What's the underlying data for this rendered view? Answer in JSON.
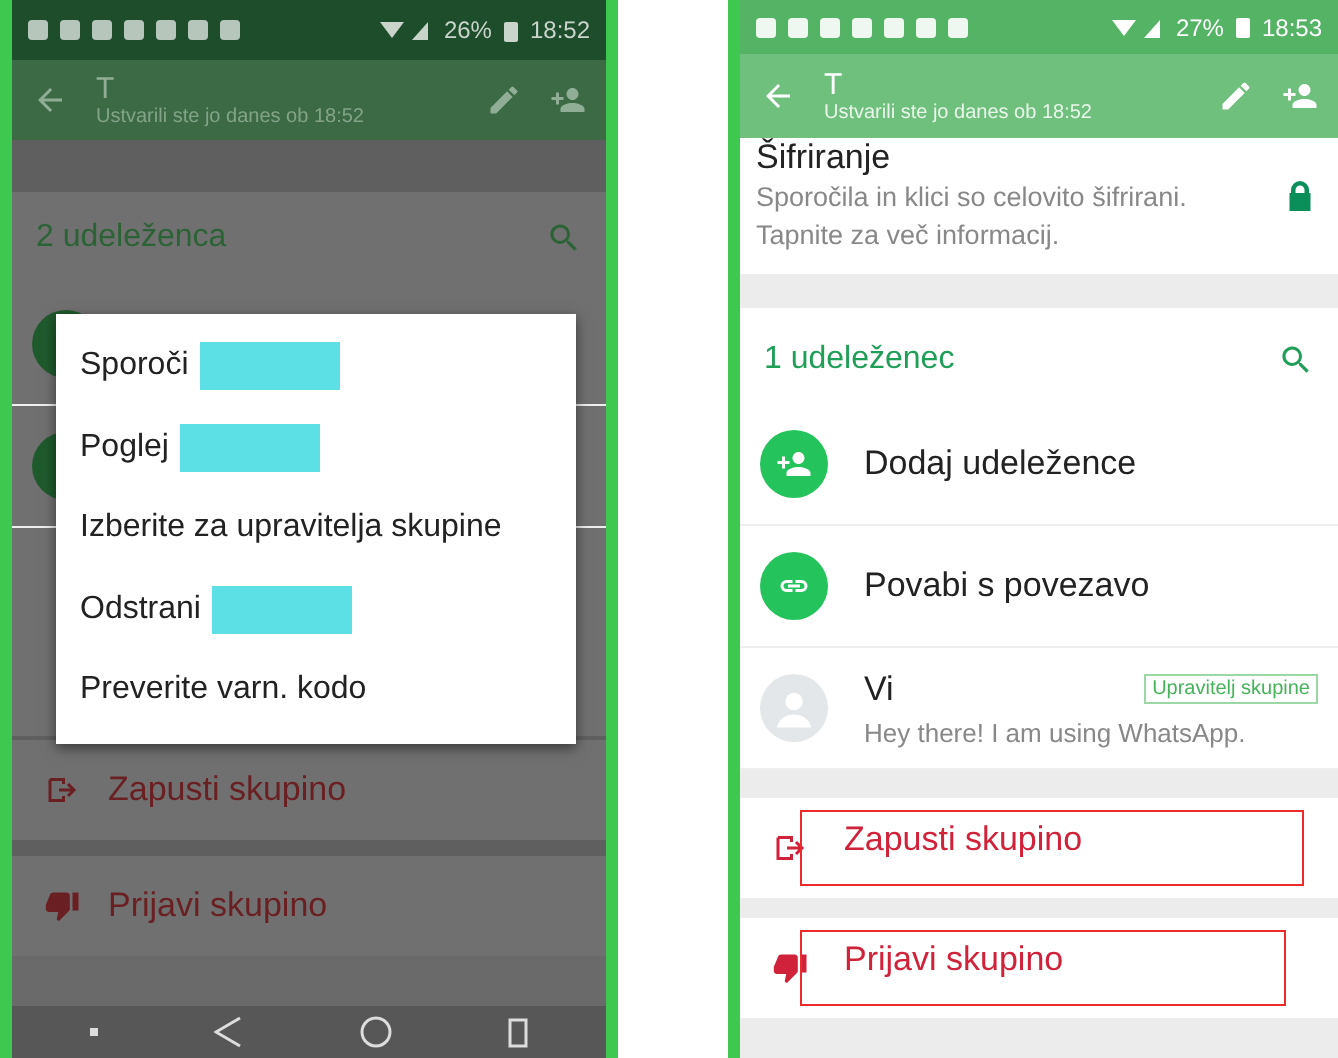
{
  "left_screen": {
    "status_bar": {
      "battery": "26%",
      "time": "18:52"
    },
    "header": {
      "title": "T",
      "subtitle": "Ustvarili ste jo danes ob 18:52"
    },
    "participants_heading": "2 udeleženca",
    "context_menu": [
      {
        "label": "Sporoči",
        "redacted": true
      },
      {
        "label": "Poglej",
        "redacted": true
      },
      {
        "label": "Izberite za upravitelja skupine",
        "redacted": false
      },
      {
        "label": "Odstrani",
        "redacted": true
      },
      {
        "label": "Preverite varn. kodo",
        "redacted": false
      }
    ],
    "actions": [
      {
        "kind": "exit",
        "label": "Zapusti skupino",
        "highlighted": false
      },
      {
        "kind": "report",
        "label": "Prijavi skupino",
        "highlighted": false
      }
    ]
  },
  "right_screen": {
    "status_bar": {
      "battery": "27%",
      "time": "18:53"
    },
    "header": {
      "title": "T",
      "subtitle": "Ustvarili ste jo danes ob 18:52"
    },
    "encryption": {
      "title": "Šifriranje",
      "text": "Sporočila in klici so celovito šifrirani. Tapnite za več informacij."
    },
    "participants_heading": "1 udeleženec",
    "participants": [
      {
        "kind": "add",
        "label": "Dodaj udeležence"
      },
      {
        "kind": "link",
        "label": "Povabi s povezavo"
      },
      {
        "kind": "member",
        "label": "Vi",
        "status": "Hey there! I am using WhatsApp.",
        "badge": "Upravitelj skupine"
      }
    ],
    "actions": [
      {
        "kind": "exit",
        "label": "Zapusti skupino",
        "highlighted": true
      },
      {
        "kind": "report",
        "label": "Prijavi skupino",
        "highlighted": true
      }
    ]
  }
}
